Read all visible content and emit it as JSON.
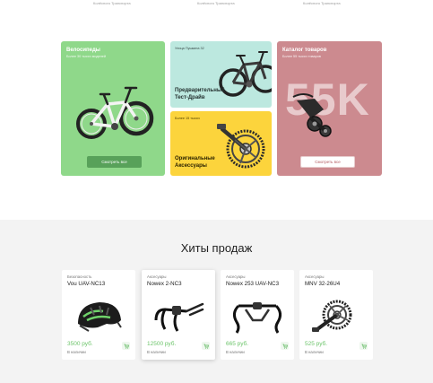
{
  "top_strip": {
    "items": [
      "Колёсного Транспорта",
      "Колёсного Транспорта",
      "Колёсного Транспорта"
    ]
  },
  "promo": {
    "bikes": {
      "title": "Велосипеды",
      "subtitle": "Более 30 тысяч моделей",
      "button": "Смотреть все"
    },
    "test_drive": {
      "address": "Улица Пушкина 32",
      "title_line1": "Предварительный",
      "title_line2": "Тест-Драйв"
    },
    "accessories": {
      "subtitle": "Более 15 тысяч",
      "title_line1": "Оригинальные",
      "title_line2": "Аксессуары"
    },
    "catalog": {
      "title": "Каталог товаров",
      "subtitle": "Более 55 тысяч товаров",
      "big_number": "55K",
      "button": "Смотреть все"
    }
  },
  "hits": {
    "heading": "Хиты продаж",
    "products": [
      {
        "category": "Безопасность",
        "name": "Vou UAV-NC13",
        "price": "3500 руб.",
        "stock": "В наличии",
        "icon": "helmet"
      },
      {
        "category": "Аксесуары",
        "name": "Nowex 2-NC3",
        "price": "12500 руб.",
        "stock": "В наличии",
        "icon": "handlebar-aero"
      },
      {
        "category": "Аксесуары",
        "name": "Nowex 253 UAV-NC3",
        "price": "665 руб.",
        "stock": "В наличии",
        "icon": "handlebar-drop"
      },
      {
        "category": "Аксесуары",
        "name": "MNV 32-26U4",
        "price": "525 руб.",
        "stock": "В наличии",
        "icon": "crankset"
      }
    ]
  },
  "colors": {
    "green": "#8fd88a",
    "mint": "#bce8df",
    "yellow": "#fcd43c",
    "rose": "#cc8a8f",
    "price": "#6cc46a"
  }
}
